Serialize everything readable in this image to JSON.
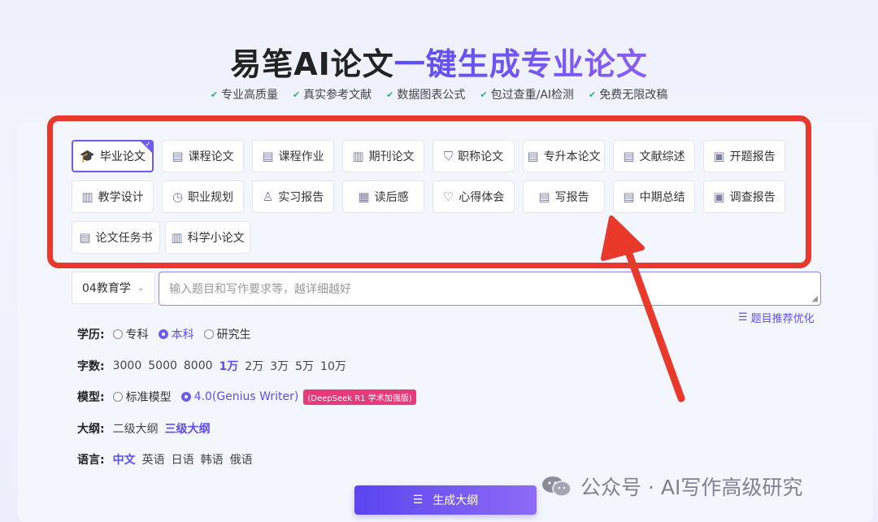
{
  "header": {
    "title_part1": "易笔AI论文",
    "title_part2": "一键生成专业论文",
    "features": [
      "专业高质量",
      "真实参考文献",
      "数据图表公式",
      "包过查重/AI检测",
      "免费无限改稿"
    ]
  },
  "paper_types": [
    {
      "label": "毕业论文",
      "icon": "graduation-cap-icon",
      "glyph": "🎓",
      "active": true
    },
    {
      "label": "课程论文",
      "icon": "document-icon",
      "glyph": "▤"
    },
    {
      "label": "课程作业",
      "icon": "document-search-icon",
      "glyph": "▤"
    },
    {
      "label": "期刊论文",
      "icon": "journal-icon",
      "glyph": "▥"
    },
    {
      "label": "职称论文",
      "icon": "shield-icon",
      "glyph": "⛉"
    },
    {
      "label": "专升本论文",
      "icon": "document-edit-icon",
      "glyph": "▤"
    },
    {
      "label": "文献综述",
      "icon": "document-list-icon",
      "glyph": "▤"
    },
    {
      "label": "开题报告",
      "icon": "report-icon",
      "glyph": "▣"
    },
    {
      "label": "教学设计",
      "icon": "book-icon",
      "glyph": "▥"
    },
    {
      "label": "职业规划",
      "icon": "clock-icon",
      "glyph": "◷"
    },
    {
      "label": "实习报告",
      "icon": "user-icon",
      "glyph": "♙"
    },
    {
      "label": "读后感",
      "icon": "calendar-icon",
      "glyph": "▦"
    },
    {
      "label": "心得体会",
      "icon": "heart-icon",
      "glyph": "♡"
    },
    {
      "label": "写报告",
      "icon": "document-search-icon",
      "glyph": "▤"
    },
    {
      "label": "中期总结",
      "icon": "clipboard-icon",
      "glyph": "▤"
    },
    {
      "label": "调查报告",
      "icon": "report-icon",
      "glyph": "▣"
    },
    {
      "label": "论文任务书",
      "icon": "clipboard-icon",
      "glyph": "▤"
    },
    {
      "label": "科学小论文",
      "icon": "book-icon",
      "glyph": "▥"
    }
  ],
  "subject_select": {
    "value": "04教育学"
  },
  "topic_input": {
    "placeholder": "输入题目和写作要求等，越详细越好"
  },
  "recommend_link": "题目推荐优化",
  "education": {
    "label": "学历:",
    "options": [
      "专科",
      "本科",
      "研究生"
    ],
    "selected": "本科"
  },
  "word_count": {
    "label": "字数:",
    "options": [
      "3000",
      "5000",
      "8000",
      "1万",
      "2万",
      "3万",
      "5万",
      "10万"
    ],
    "selected": "1万"
  },
  "model": {
    "label": "模型:",
    "options": [
      "标准模型",
      "4.0(Genius Writer)"
    ],
    "selected": "4.0(Genius Writer)",
    "badge": "(DeepSeek R1 学术加强版)"
  },
  "outline": {
    "label": "大纲:",
    "options": [
      "二级大纲",
      "三级大纲"
    ],
    "selected": "三级大纲"
  },
  "language": {
    "label": "语言:",
    "options": [
      "中文",
      "英语",
      "日语",
      "韩语",
      "俄语"
    ],
    "selected": "中文"
  },
  "generate_button": "生成大纲",
  "watermark": "公众号 · AI写作高级研究",
  "colors": {
    "accent": "#6b5bf0",
    "annotation_red": "#e8392b",
    "badge_pink": "#e8397a"
  }
}
